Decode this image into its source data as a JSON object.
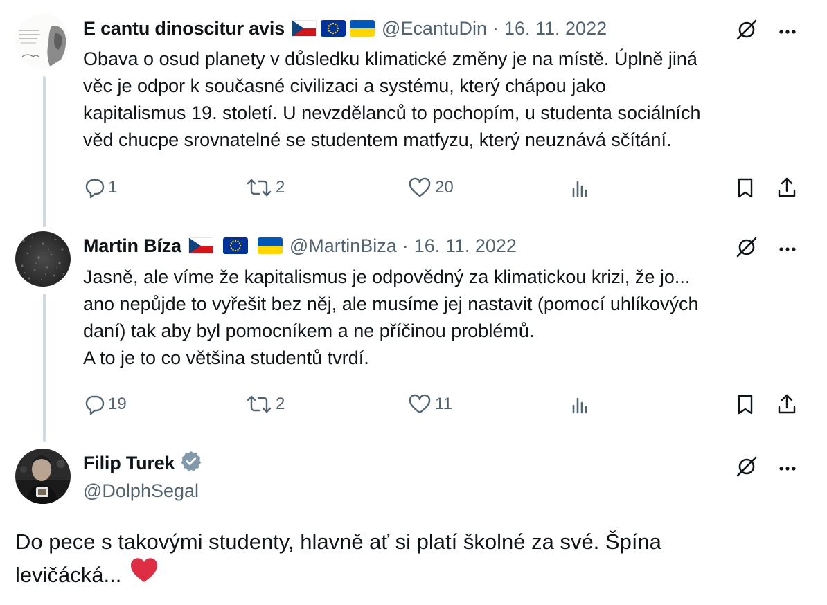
{
  "tweets": [
    {
      "name": "E cantu dinoscitur avis",
      "handle": "@EcantuDin",
      "sep": "·",
      "date": "16. 11. 2022",
      "lines": [
        "Obava o osud planety v důsledku klimatické změny je na místě. Úplně jiná",
        "věc je odpor k současné civilizaci a systému, který chápou jako",
        "kapitalismus 19. století. U nevzdělanců to pochopím, u studenta sociálních",
        "věd chucpe srovnatelné se studentem matfyzu, který neuznává sčítání."
      ],
      "replies": "1",
      "reposts": "2",
      "likes": "20"
    },
    {
      "name": "Martin Bíza",
      "handle": "@MartinBiza",
      "sep": "·",
      "date": "16. 11. 2022",
      "lines": [
        "Jasně, ale víme že kapitalismus je odpovědný za klimatickou krizi, že jo...",
        "ano nepůjde to vyřešit bez něj, ale musíme jej nastavit (pomocí uhlíkových",
        "daní) tak aby byl pomocníkem a ne příčinou problémů.",
        "A to je to co většina studentů tvrdí."
      ],
      "replies": "19",
      "reposts": "2",
      "likes": "11"
    }
  ],
  "main": {
    "name": "Filip Turek",
    "handle": "@DolphSegal",
    "verified_icon": "verified-badge-icon",
    "text_line1": "Do pece s takovými studenty, hlavně ať si platí školné za své. Špína",
    "text_line2": "levičácká...",
    "emoji": "heart-emoji"
  },
  "colors": {
    "text": "#0f1419",
    "muted": "#536471",
    "thread_line": "#cfd9de",
    "verified": "#829aab",
    "heart": "#dd2e44"
  },
  "icons": [
    "grok-icon",
    "more-icon",
    "reply-icon",
    "repost-icon",
    "like-icon",
    "views-icon",
    "bookmark-icon",
    "share-icon",
    "flag-cz-icon",
    "flag-eu-icon",
    "flag-ua-icon"
  ]
}
